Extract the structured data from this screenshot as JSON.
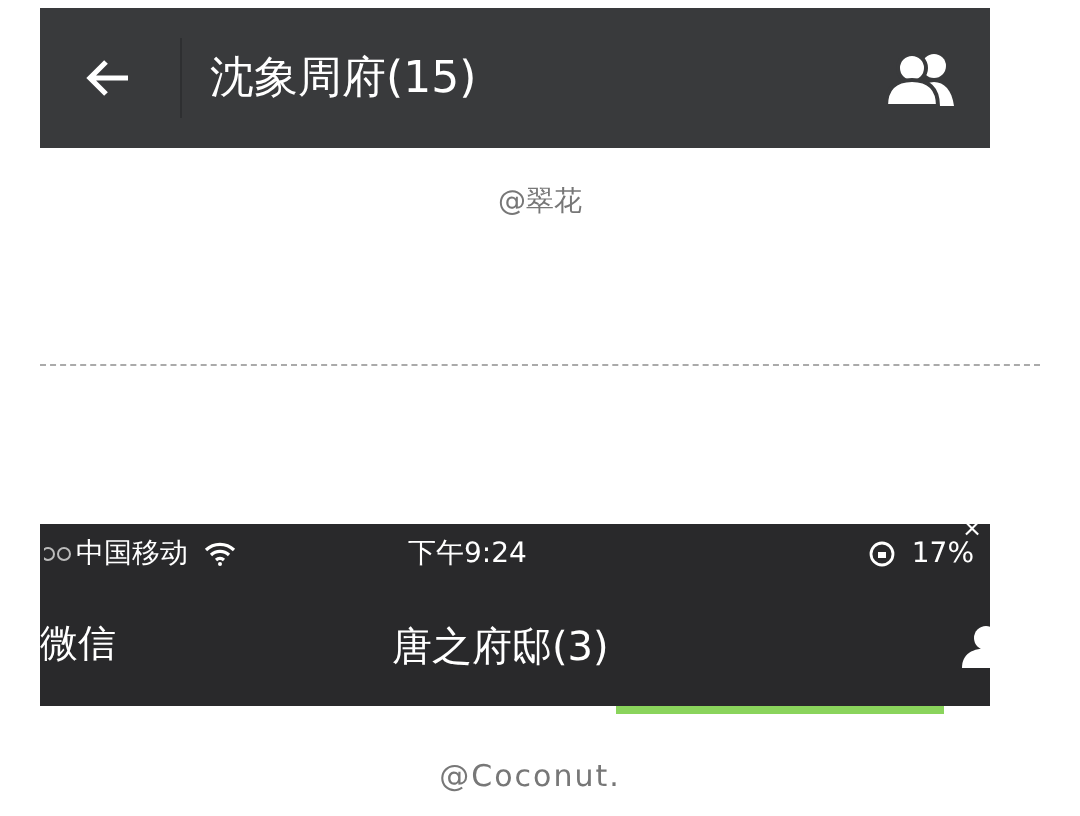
{
  "first_screen": {
    "title": "沈象周府(15)",
    "caption": "@翠花"
  },
  "second_screen": {
    "status_bar": {
      "carrier": "中国移动",
      "time": "下午9:24",
      "battery": "17%",
      "close_mark": "×"
    },
    "back_label": "微信",
    "title": "唐之府邸(3)",
    "caption": "@Coconut."
  }
}
